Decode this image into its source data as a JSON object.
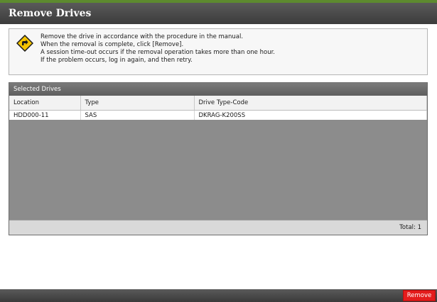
{
  "dialog": {
    "title": "Remove Drives"
  },
  "message": {
    "icon": "warning-diamond-icon",
    "lines": [
      "Remove the drive in accordance with the procedure in the manual.",
      "When the removal is complete, click [Remove].",
      "A session time-out occurs if the removal operation takes more than one hour.",
      "If the problem occurs, log in again, and then retry."
    ]
  },
  "selected_drives": {
    "header": "Selected Drives",
    "columns": [
      "Location",
      "Type",
      "Drive Type-Code"
    ],
    "rows": [
      [
        "HDD000-11",
        "SAS",
        "DKRAG-K200SS"
      ]
    ],
    "total_label": "Total: 1"
  },
  "footer": {
    "remove_label": "Remove"
  },
  "colors": {
    "accent": "#5d8a2f",
    "remove_button": "#e41c1c",
    "warning_icon": "#f5c400"
  }
}
